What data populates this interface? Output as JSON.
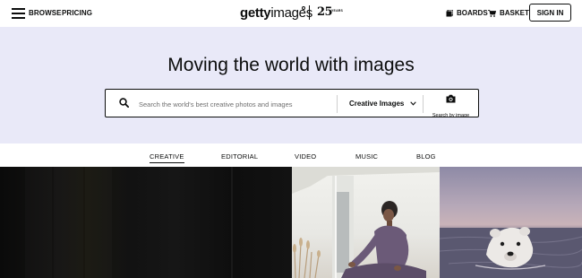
{
  "header": {
    "browse_label": "BROWSE",
    "pricing_label": "PRICING",
    "logo_bold": "getty",
    "logo_light": "images",
    "anniversary_number": "25",
    "anniversary_word": "YEARS",
    "boards_label": "BOARDS",
    "basket_label": "BASKET",
    "signin_label": "SIGN IN"
  },
  "hero": {
    "title": "Moving the world with images",
    "background_color": "#e9e9f8"
  },
  "search": {
    "placeholder": "Search the world's best creative photos and images",
    "value": "",
    "category_selected": "Creative Images",
    "search_by_image_label": "Search by image"
  },
  "tabs": [
    {
      "label": "CREATIVE",
      "active": true
    },
    {
      "label": "EDITORIAL",
      "active": false
    },
    {
      "label": "VIDEO",
      "active": false
    },
    {
      "label": "MUSIC",
      "active": false
    },
    {
      "label": "BLOG",
      "active": false
    }
  ],
  "icons": {
    "menu": "hamburger-menu-icon",
    "search": "magnifier-icon",
    "camera": "camera-icon",
    "boards": "boards-icon",
    "basket": "shopping-cart-icon",
    "chevron": "chevron-down-icon"
  }
}
